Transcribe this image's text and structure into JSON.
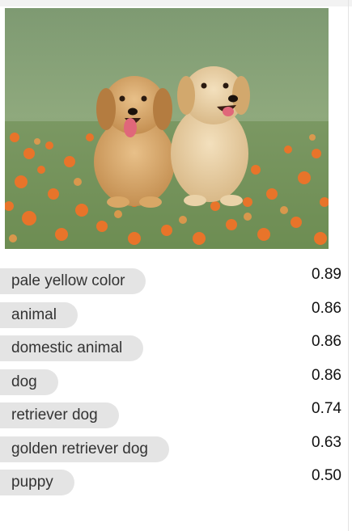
{
  "image": {
    "icon": "golden-retriever-puppies-photo"
  },
  "tags": [
    {
      "label": "pale yellow color",
      "score": "0.89"
    },
    {
      "label": "animal",
      "score": "0.86"
    },
    {
      "label": "domestic animal",
      "score": "0.86"
    },
    {
      "label": "dog",
      "score": "0.86"
    },
    {
      "label": "retriever dog",
      "score": "0.74"
    },
    {
      "label": "golden retriever dog",
      "score": "0.63"
    },
    {
      "label": "puppy",
      "score": "0.50"
    }
  ],
  "colors": {
    "pill_background": "#e4e4e4",
    "pill_text": "#333333",
    "score_text": "#111111"
  }
}
